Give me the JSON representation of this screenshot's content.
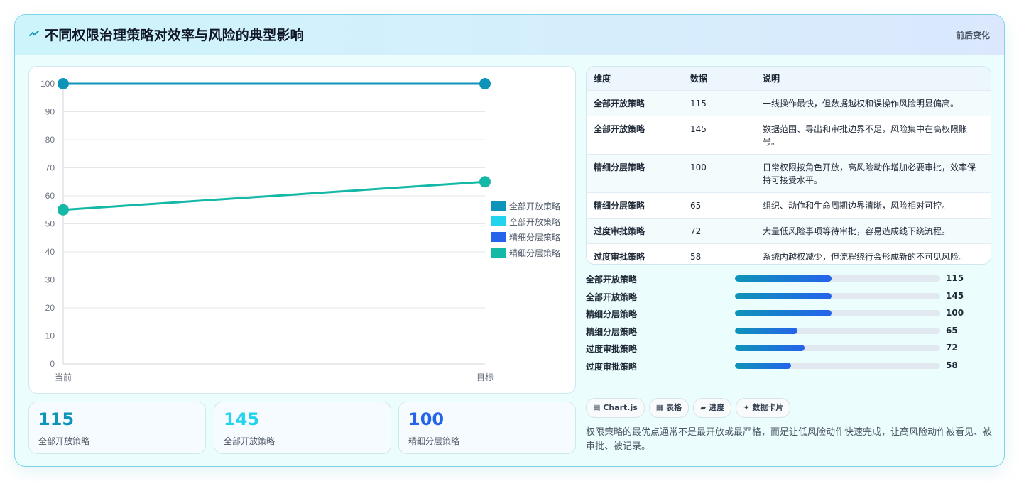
{
  "header": {
    "title": "不同权限治理策略对效率与风险的典型影响",
    "right_label": "前后变化"
  },
  "chart_data": {
    "type": "line",
    "x": [
      "当前",
      "目标"
    ],
    "ylim": [
      0,
      100
    ],
    "yticks": [
      0,
      10,
      20,
      30,
      40,
      50,
      60,
      70,
      80,
      90,
      100
    ],
    "legend_position": "right",
    "series": [
      {
        "name": "全部开放策略",
        "values": [
          100,
          100
        ],
        "color": "#0e94b8",
        "visible_line": true
      },
      {
        "name": "全部开放策略",
        "values": [
          100,
          100
        ],
        "color": "#22d3ee",
        "visible_line": false
      },
      {
        "name": "精细分层策略",
        "values": [
          100,
          100
        ],
        "color": "#2563eb",
        "visible_line": false
      },
      {
        "name": "精细分层策略",
        "values": [
          55,
          65
        ],
        "color": "#14b8a6",
        "visible_line": true
      }
    ]
  },
  "stats": [
    {
      "value": "115",
      "label": "全部开放策略",
      "color": "#0e94b8"
    },
    {
      "value": "145",
      "label": "全部开放策略",
      "color": "#22d3ee"
    },
    {
      "value": "100",
      "label": "精细分层策略",
      "color": "#2563eb"
    }
  ],
  "table": {
    "headers": [
      "维度",
      "数据",
      "说明"
    ],
    "rows": [
      {
        "dim": "全部开放策略",
        "value": "115",
        "desc": "一线操作最快，但数据越权和误操作风险明显偏高。"
      },
      {
        "dim": "全部开放策略",
        "value": "145",
        "desc": "数据范围、导出和审批边界不足，风险集中在高权限账号。"
      },
      {
        "dim": "精细分层策略",
        "value": "100",
        "desc": "日常权限按角色开放，高风险动作增加必要审批，效率保持可接受水平。"
      },
      {
        "dim": "精细分层策略",
        "value": "65",
        "desc": "组织、动作和生命周期边界清晰，风险相对可控。"
      },
      {
        "dim": "过度审批策略",
        "value": "72",
        "desc": "大量低风险事项等待审批，容易造成线下绕流程。"
      },
      {
        "dim": "过度审批策略",
        "value": "58",
        "desc": "系统内越权减少，但流程绕行会形成新的不可见风险。"
      }
    ]
  },
  "progress": {
    "max": 100,
    "items": [
      {
        "label": "全部开放策略",
        "value": 115
      },
      {
        "label": "全部开放策略",
        "value": 145
      },
      {
        "label": "精细分层策略",
        "value": 100
      },
      {
        "label": "精细分层策略",
        "value": 65
      },
      {
        "label": "过度审批策略",
        "value": 72
      },
      {
        "label": "过度审批策略",
        "value": 58
      }
    ]
  },
  "chips": [
    {
      "icon": "chart-icon",
      "glyph": "▤",
      "label": "Chart.js"
    },
    {
      "icon": "table-icon",
      "glyph": "▦",
      "label": "表格"
    },
    {
      "icon": "progress-icon",
      "glyph": "▰",
      "label": "进度"
    },
    {
      "icon": "sparkle-icon",
      "glyph": "✦",
      "label": "数据卡片"
    }
  ],
  "footer_text": "权限策略的最优点通常不是最开放或最严格，而是让低风险动作快速完成，让高风险动作被看见、被审批、被记录。"
}
